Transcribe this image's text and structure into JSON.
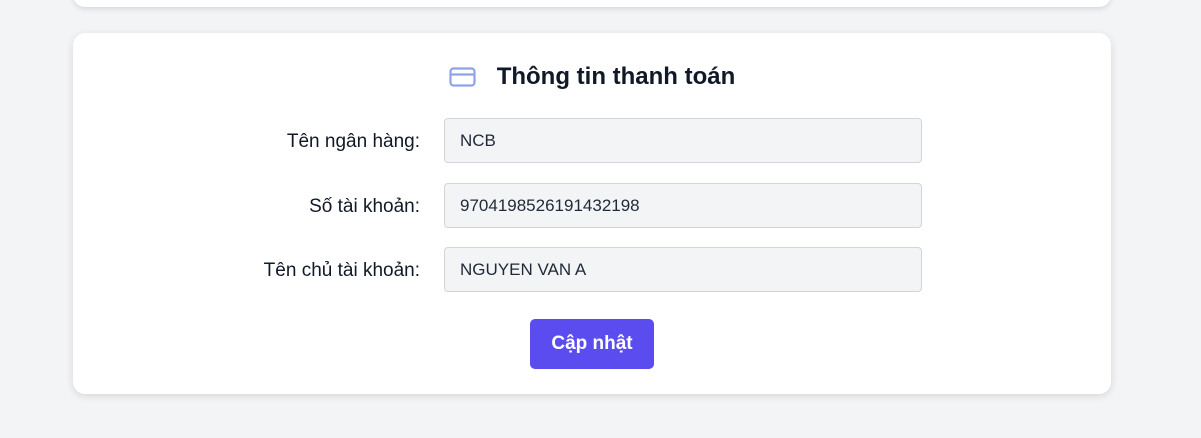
{
  "payment_section": {
    "title": "Thông tin thanh toán",
    "icon": "credit-card-icon",
    "accent_color": "#5b4cf0",
    "icon_color": "#8ea1e9",
    "fields": [
      {
        "label": "Tên ngân hàng:",
        "value": "NCB"
      },
      {
        "label": "Số tài khoản:",
        "value": "9704198526191432198"
      },
      {
        "label": "Tên chủ tài khoản:",
        "value": "NGUYEN VAN A"
      }
    ],
    "update_button_label": "Cập nhật"
  }
}
